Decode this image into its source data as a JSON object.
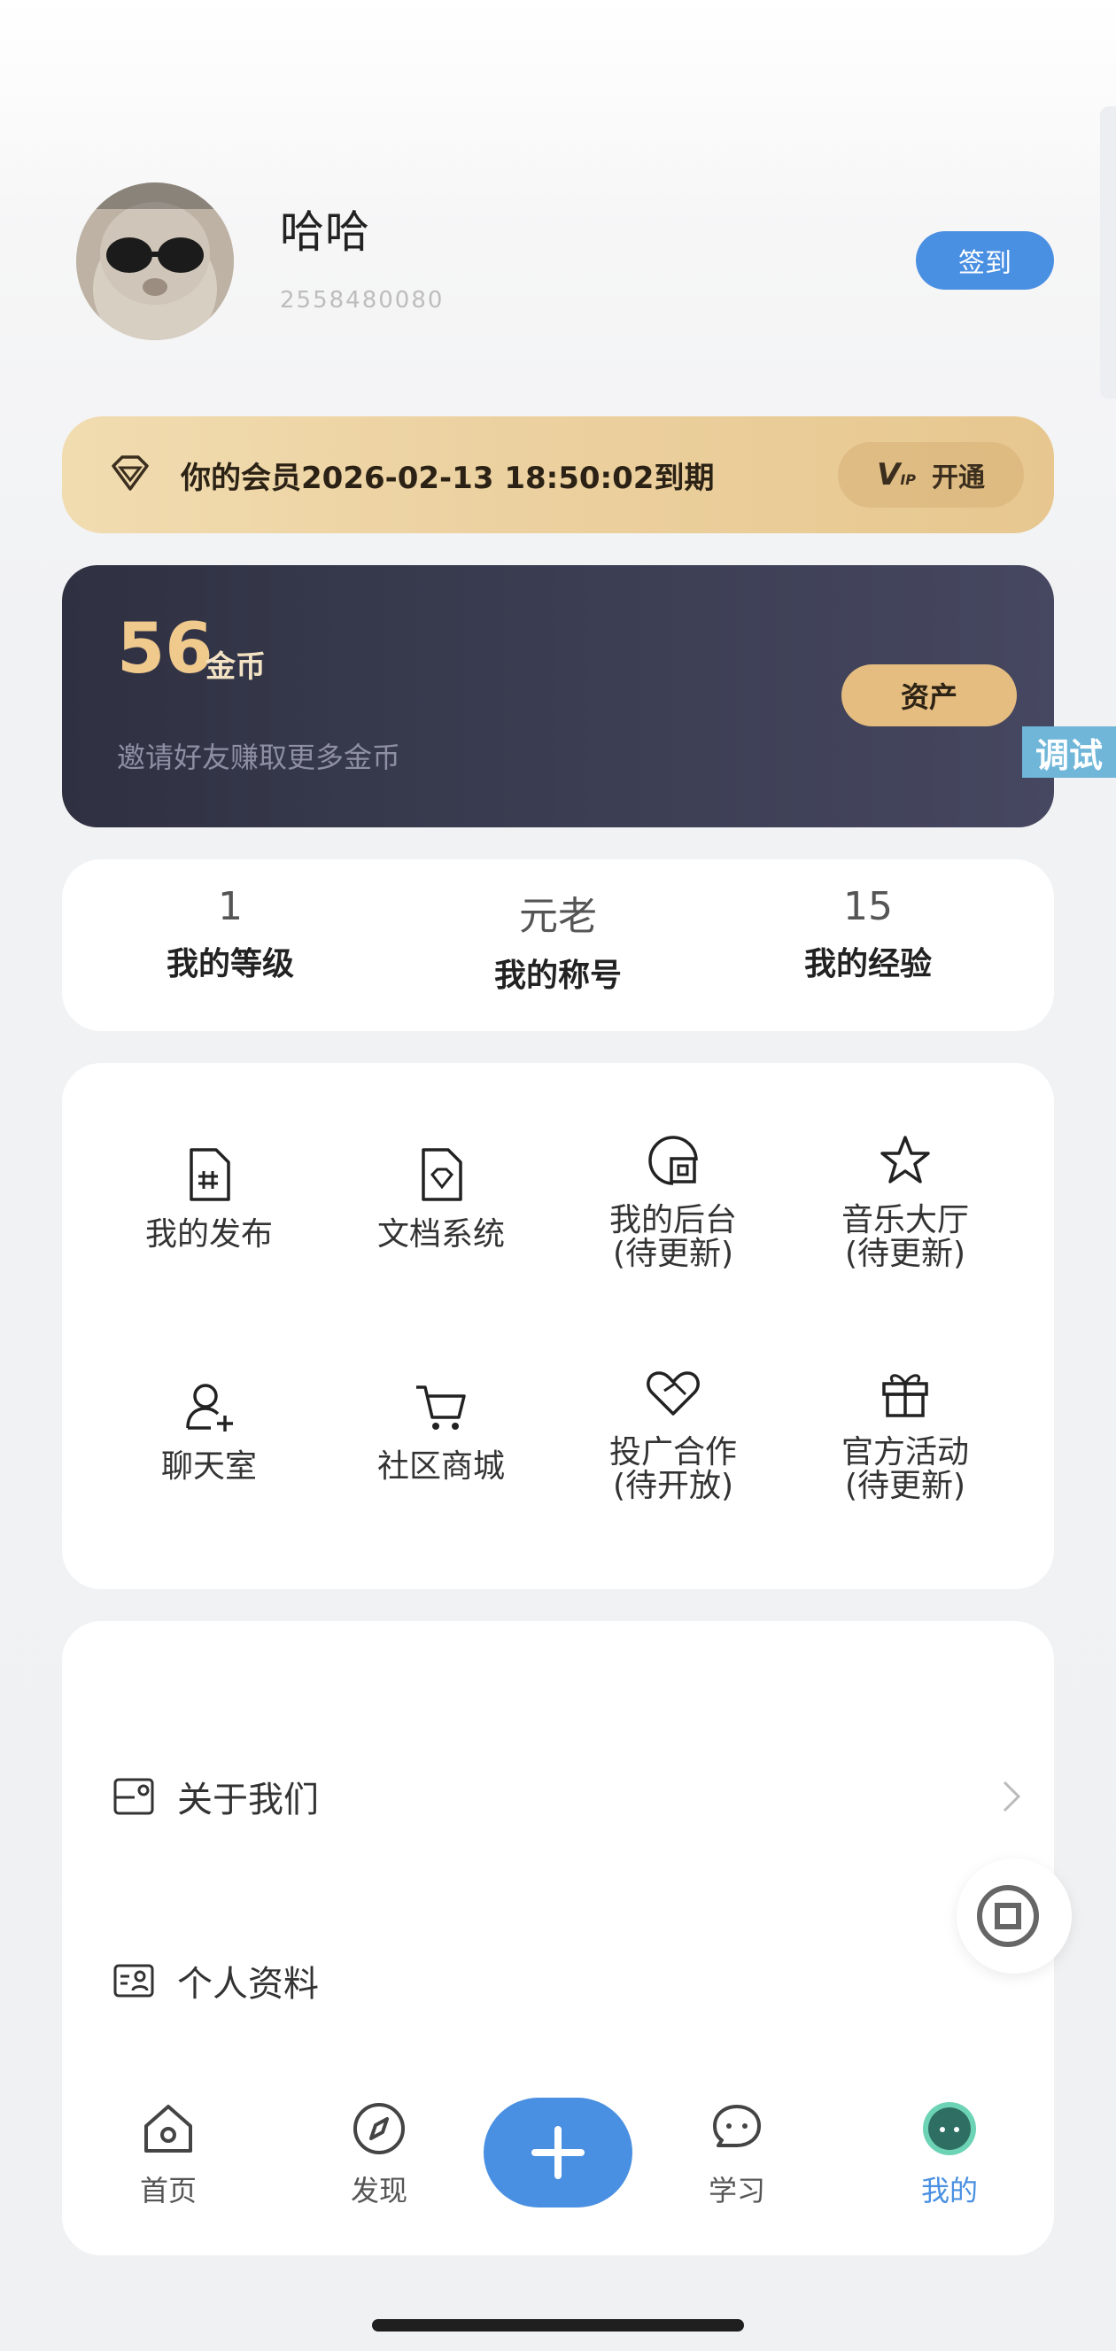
{
  "profile": {
    "name": "哈哈",
    "id": "2558480080",
    "signin_label": "签到"
  },
  "vip": {
    "text": "你的会员2026-02-13 18:50:02到期",
    "logo": "V",
    "logo_sub": "IP",
    "open_label": "开通"
  },
  "coins": {
    "amount": "56",
    "unit": "金币",
    "subtitle": "邀请好友赚取更多金币",
    "assets_label": "资产"
  },
  "debug_tag": "调试",
  "stats": [
    {
      "value": "1",
      "label": "我的等级"
    },
    {
      "value": "元老",
      "label": "我的称号"
    },
    {
      "value": "15",
      "label": "我的经验"
    }
  ],
  "grid": [
    {
      "label": "我的发布",
      "sub": "",
      "icon": "doc-hash-icon"
    },
    {
      "label": "文档系统",
      "sub": "",
      "icon": "doc-diamond-icon"
    },
    {
      "label": "我的后台",
      "sub": "(待更新)",
      "icon": "backend-icon"
    },
    {
      "label": "音乐大厅",
      "sub": "(待更新)",
      "icon": "star-icon"
    },
    {
      "label": "聊天室",
      "sub": "",
      "icon": "user-add-icon"
    },
    {
      "label": "社区商城",
      "sub": "",
      "icon": "cart-icon"
    },
    {
      "label": "投广合作",
      "sub": "(待开放)",
      "icon": "handshake-heart-icon"
    },
    {
      "label": "官方活动",
      "sub": "(待更新)",
      "icon": "gift-icon"
    }
  ],
  "list": [
    {
      "label": "关于我们",
      "icon": "about-icon"
    },
    {
      "label": "个人资料",
      "icon": "profile-card-icon"
    }
  ],
  "tabs": [
    {
      "label": "首页",
      "icon": "home-icon"
    },
    {
      "label": "发现",
      "icon": "compass-icon"
    },
    {
      "label": "学习",
      "icon": "chat-icon"
    },
    {
      "label": "我的",
      "icon": "me-icon",
      "active": true
    }
  ],
  "colors": {
    "accent": "#4a90e2",
    "gold": "#e5bd80",
    "dark_card": "#3d3f55"
  }
}
